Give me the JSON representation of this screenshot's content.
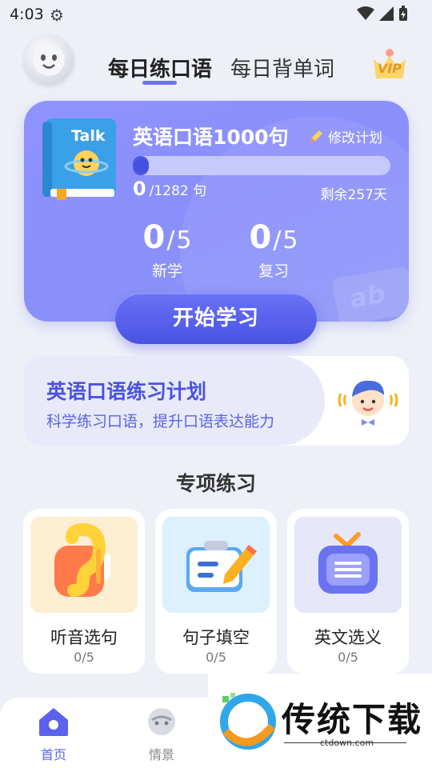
{
  "status_bar": {
    "time": "4:03"
  },
  "header": {
    "tabs": [
      {
        "label": "每日练口语",
        "active": true
      },
      {
        "label": "每日背单词",
        "active": false
      }
    ],
    "vip_label": "VIP"
  },
  "plan": {
    "course_title": "英语口语1000句",
    "edit_label": "修改计划",
    "learned": "0",
    "total_text": "/1282 句",
    "progress_fraction": 0,
    "remaining": "剩余257天",
    "new": {
      "value": "0",
      "total": "5",
      "label": "新学"
    },
    "review": {
      "value": "0",
      "total": "5",
      "label": "复习"
    },
    "start_button": "开始学习"
  },
  "book_cover_text": "Talk",
  "practice_plan": {
    "title": "英语口语练习计划",
    "subtitle": "科学练习口语，提升口语表达能力"
  },
  "special_section": {
    "title": "专项练习",
    "items": [
      {
        "label": "听音选句",
        "count": "0/5",
        "bg": "#fdeed2",
        "icon": "ear-icon"
      },
      {
        "label": "句子填空",
        "count": "0/5",
        "bg": "#dcf0fd",
        "icon": "notepad-pencil-icon"
      },
      {
        "label": "英文选义",
        "count": "0/5",
        "bg": "#e6e7f8",
        "icon": "tv-icon"
      }
    ]
  },
  "bottom_nav": {
    "items": [
      {
        "label": "首页",
        "icon": "home-icon",
        "active": true
      },
      {
        "label": "情景",
        "icon": "scene-icon",
        "active": false
      }
    ]
  },
  "watermark": {
    "brand": "传统下载",
    "url": "ctdown.com"
  },
  "colors": {
    "accent": "#5a62ee",
    "card": "#8c91fc",
    "button": "#4f57e6"
  }
}
